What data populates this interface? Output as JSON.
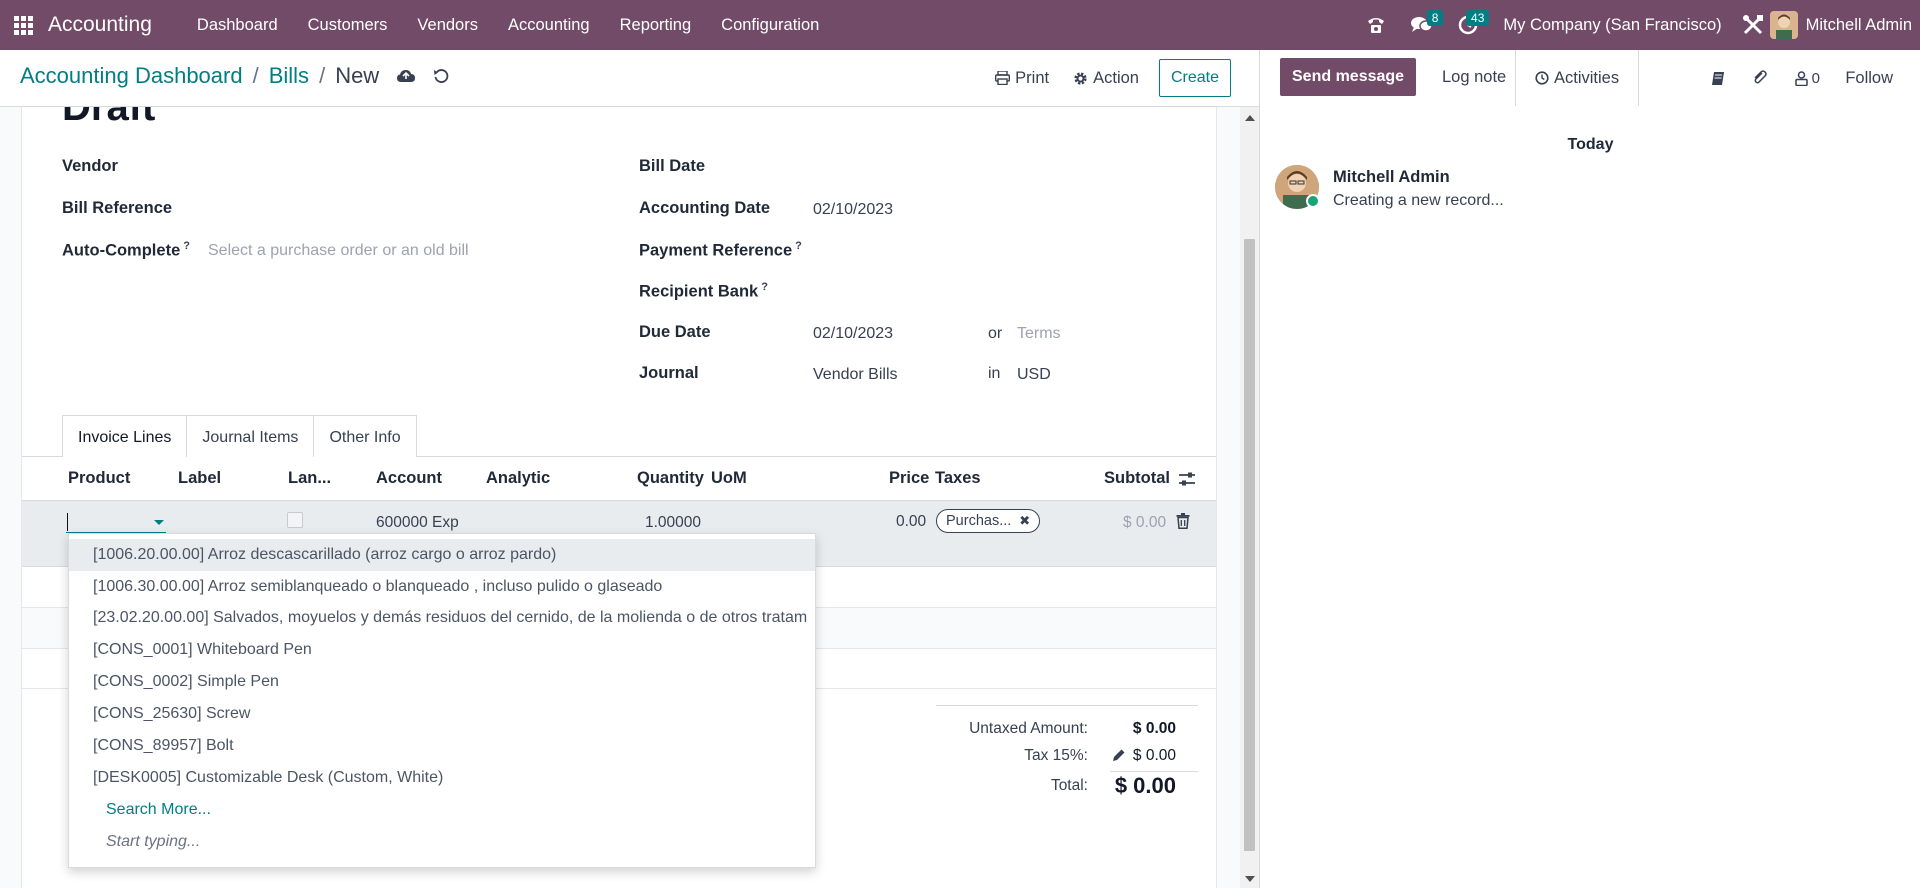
{
  "navbar": {
    "brand": "Accounting",
    "menu": [
      "Dashboard",
      "Customers",
      "Vendors",
      "Accounting",
      "Reporting",
      "Configuration"
    ],
    "messages_badge": "8",
    "activities_badge": "43",
    "company": "My Company (San Francisco)",
    "user": "Mitchell Admin"
  },
  "control": {
    "breadcrumb": [
      "Accounting Dashboard",
      "Bills",
      "New"
    ],
    "print_label": "Print",
    "action_label": "Action",
    "create_label": "Create"
  },
  "form": {
    "status_title": "Draft",
    "left_fields": {
      "vendor_label": "Vendor",
      "bill_reference_label": "Bill Reference",
      "auto_complete_label": "Auto-Complete",
      "auto_complete_placeholder": "Select a purchase order or an old bill"
    },
    "right_fields": {
      "bill_date_label": "Bill Date",
      "accounting_date_label": "Accounting Date",
      "accounting_date_value": "02/10/2023",
      "payment_reference_label": "Payment Reference",
      "recipient_bank_label": "Recipient Bank",
      "due_date_label": "Due Date",
      "due_date_value": "02/10/2023",
      "or_text": "or",
      "terms_placeholder": "Terms",
      "journal_label": "Journal",
      "journal_value": "Vendor Bills",
      "in_text": "in",
      "currency_value": "USD"
    },
    "tooltip_marker": "?",
    "tabs": [
      "Invoice Lines",
      "Journal Items",
      "Other Info"
    ],
    "columns": {
      "product": "Product",
      "label": "Label",
      "landed": "Lan...",
      "account": "Account",
      "analytic": "Analytic",
      "quantity": "Quantity",
      "uom": "UoM",
      "price": "Price",
      "taxes": "Taxes",
      "subtotal": "Subtotal"
    },
    "edit_row": {
      "account": "600000 Exp",
      "quantity": "1.00000",
      "price": "0.00",
      "tax_tag": "Purchas...",
      "subtotal": "$ 0.00"
    },
    "totals": {
      "untaxed_label": "Untaxed Amount:",
      "untaxed_value": "$ 0.00",
      "tax_label": "Tax 15%:",
      "tax_value": "$ 0.00",
      "total_label": "Total:",
      "total_value": "$ 0.00"
    }
  },
  "dropdown": {
    "items": [
      "[1006.20.00.00] Arroz descascarillado (arroz cargo o arroz pardo)",
      "[1006.30.00.00] Arroz semiblanqueado o blanqueado , incluso pulido o glaseado",
      "[23.02.20.00.00] Salvados, moyuelos y demás residuos del cernido, de la molienda o de otros tratam",
      "[CONS_0001] Whiteboard Pen",
      "[CONS_0002] Simple Pen",
      "[CONS_25630] Screw",
      "[CONS_89957] Bolt",
      "[DESK0005] Customizable Desk (Custom, White)"
    ],
    "search_more": "Search More...",
    "start_typing": "Start typing..."
  },
  "chatter": {
    "send_message": "Send message",
    "log_note": "Log note",
    "activities": "Activities",
    "followers_count": "0",
    "follow": "Follow",
    "date_separator": "Today",
    "message_author": "Mitchell Admin",
    "message_body": "Creating a new record..."
  },
  "colors": {
    "brand": "#714b67",
    "accent": "#017e84"
  }
}
